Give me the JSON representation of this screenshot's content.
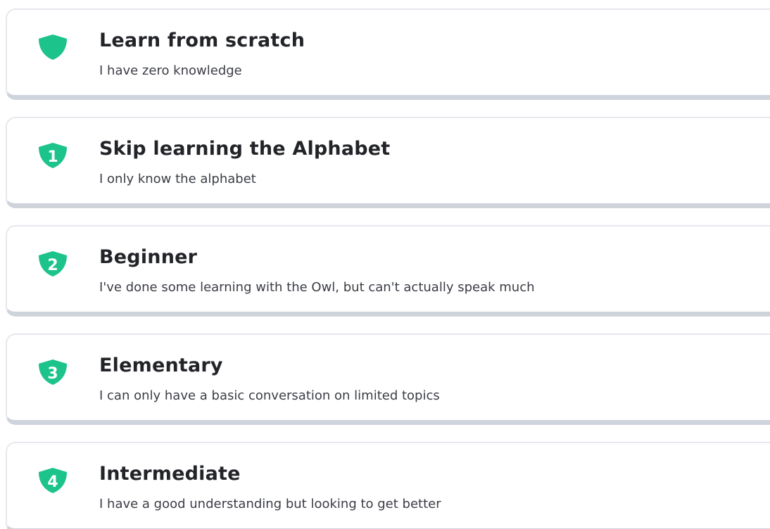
{
  "accent_color": "#1cc38b",
  "levels": [
    {
      "icon": "shield-icon",
      "badge": "",
      "title": "Learn from scratch",
      "subtitle": "I have zero knowledge"
    },
    {
      "icon": "shield-1-icon",
      "badge": "1",
      "title": "Skip learning the Alphabet",
      "subtitle": "I only know the alphabet"
    },
    {
      "icon": "shield-2-icon",
      "badge": "2",
      "title": "Beginner",
      "subtitle": "I've done some learning with the Owl, but can't actually speak much"
    },
    {
      "icon": "shield-3-icon",
      "badge": "3",
      "title": "Elementary",
      "subtitle": "I can only have a basic conversation on limited topics"
    },
    {
      "icon": "shield-4-icon",
      "badge": "4",
      "title": "Intermediate",
      "subtitle": "I have a good understanding but looking to get better"
    }
  ]
}
